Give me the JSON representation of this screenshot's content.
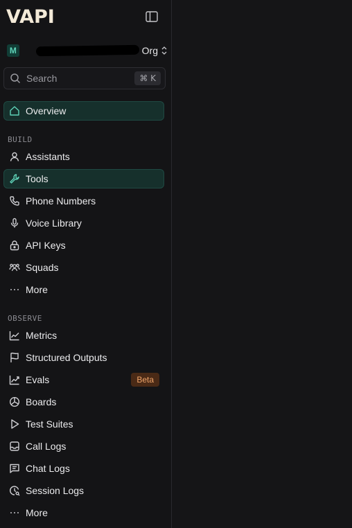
{
  "brand": {
    "logo_text": "VAPI"
  },
  "org": {
    "avatar_letter": "M",
    "label": "Org"
  },
  "search": {
    "placeholder": "Search",
    "shortcut": "⌘ K"
  },
  "nav": {
    "overview": "Overview",
    "build_section": "BUILD",
    "build_items": [
      {
        "label": "Assistants",
        "icon": "user-icon"
      },
      {
        "label": "Tools",
        "icon": "wrench-icon",
        "active": true
      },
      {
        "label": "Phone Numbers",
        "icon": "phone-icon"
      },
      {
        "label": "Voice Library",
        "icon": "mic-icon"
      },
      {
        "label": "API Keys",
        "icon": "lock-icon"
      },
      {
        "label": "Squads",
        "icon": "users-icon"
      },
      {
        "label": "More",
        "icon": "ellipsis-icon"
      }
    ],
    "observe_section": "OBSERVE",
    "observe_items": [
      {
        "label": "Metrics",
        "icon": "line-chart-icon"
      },
      {
        "label": "Structured Outputs",
        "icon": "flag-icon"
      },
      {
        "label": "Evals",
        "icon": "trending-icon",
        "badge": "Beta"
      },
      {
        "label": "Boards",
        "icon": "pie-icon"
      },
      {
        "label": "Test Suites",
        "icon": "play-icon"
      },
      {
        "label": "Call Logs",
        "icon": "inbox-icon"
      },
      {
        "label": "Chat Logs",
        "icon": "message-icon"
      },
      {
        "label": "Session Logs",
        "icon": "session-icon"
      },
      {
        "label": "More",
        "icon": "ellipsis-icon"
      }
    ]
  },
  "colors": {
    "background": "#141416",
    "accent": "#5fd3b8",
    "active_bg": "#16302c",
    "badge_bg": "#4a2a16",
    "badge_fg": "#f0a56a"
  }
}
